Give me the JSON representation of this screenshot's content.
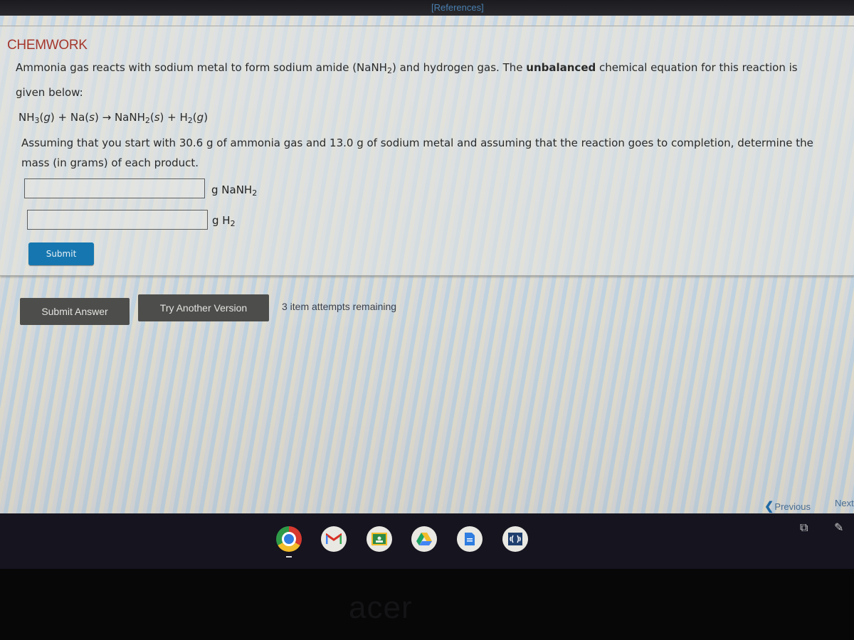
{
  "top_bar": {
    "references_label": "[References]"
  },
  "question": {
    "brand": "CHEMWORK",
    "intro_part1": "Ammonia gas reacts with sodium metal to form sodium amide (NaNH",
    "intro_sub": "2",
    "intro_part2": ") and hydrogen gas. The ",
    "intro_bold": "unbalanced",
    "intro_part3": " chemical equation for this reaction is",
    "intro_line2": "given below:",
    "equation": {
      "reactant1": "NH",
      "reactant1_sub": "3",
      "reactant1_state": "g",
      "plus1": " + ",
      "reactant2": "Na",
      "reactant2_state": "s",
      "arrow": " → ",
      "product1": "NaNH",
      "product1_sub": "2",
      "product1_state": "s",
      "plus2": " + ",
      "product2": "H",
      "product2_sub": "2",
      "product2_state": "g"
    },
    "prompt_line1": "Assuming that you start with 30.6 g of ammonia gas and 13.0 g of sodium metal and assuming that the reaction goes to completion, determine the",
    "prompt_line2": "mass (in grams) of each product.",
    "answers": [
      {
        "value": "",
        "unit_prefix": "g NaNH",
        "unit_sub": "2"
      },
      {
        "value": "",
        "unit_prefix": "g H",
        "unit_sub": "2"
      }
    ],
    "submit_label": "Submit"
  },
  "actions": {
    "submit_answer_label": "Submit Answer",
    "try_another_label": "Try Another Version",
    "attempts_text": "3 item attempts remaining"
  },
  "pagination": {
    "previous_label": "Previous",
    "next_label": "Next"
  },
  "shelf": {
    "apps": [
      "Chrome",
      "Gmail",
      "Google Classroom",
      "Google Drive",
      "Google Docs",
      "Meet"
    ]
  },
  "bezel": {
    "logo": "acer"
  }
}
